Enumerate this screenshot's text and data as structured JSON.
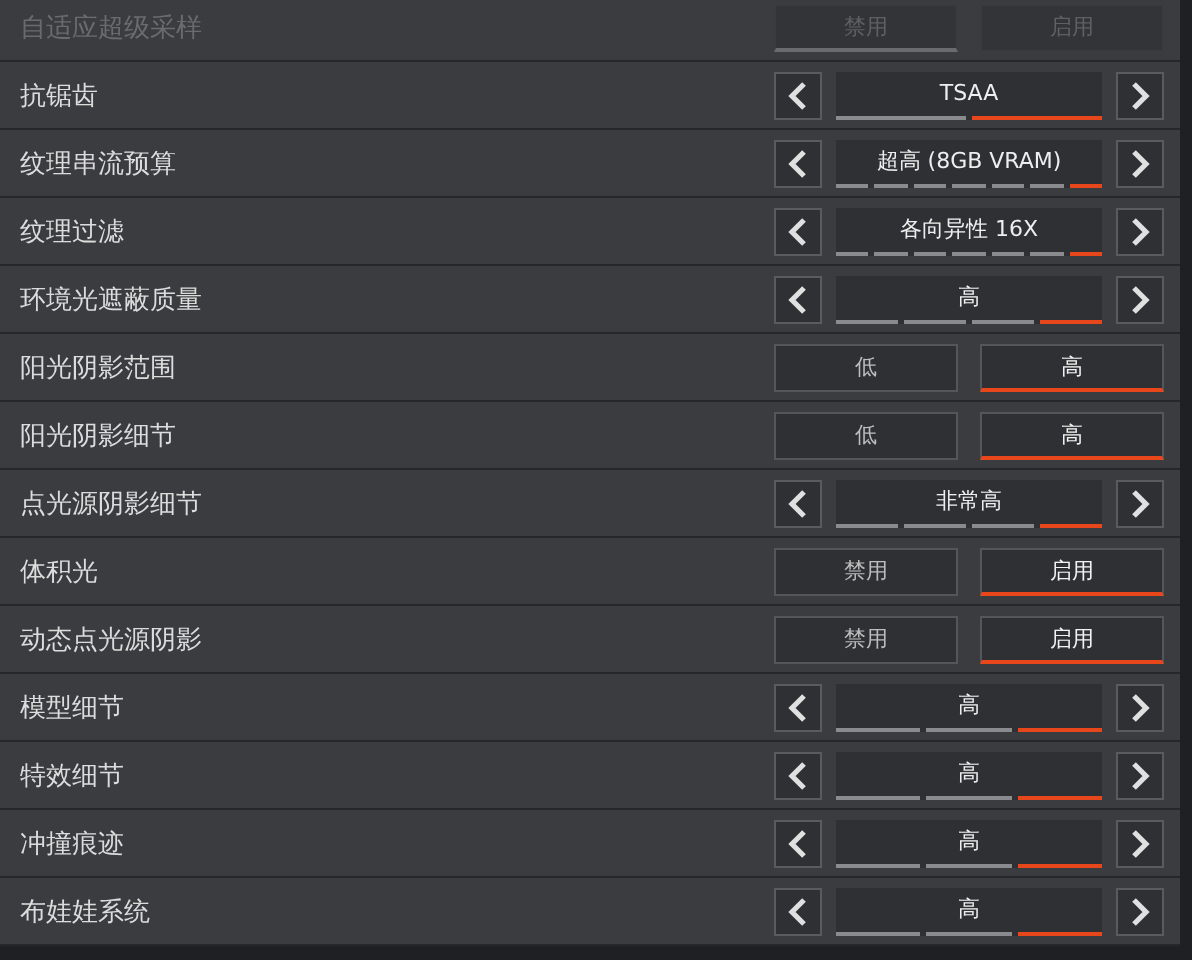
{
  "settings": [
    {
      "label": "自适应超级采样",
      "kind": "toggle",
      "disabled": true,
      "options": [
        {
          "label": "禁用",
          "selected": true
        },
        {
          "label": "启用",
          "selected": false
        }
      ]
    },
    {
      "label": "抗锯齿",
      "kind": "stepper",
      "disabled": false,
      "value": "TSAA",
      "segments": [
        {
          "selected": false
        },
        {
          "selected": true
        }
      ]
    },
    {
      "label": "纹理串流预算",
      "kind": "stepper",
      "disabled": false,
      "value": "超高 (8GB VRAM)",
      "segments": [
        {
          "selected": false
        },
        {
          "selected": false
        },
        {
          "selected": false
        },
        {
          "selected": false
        },
        {
          "selected": false
        },
        {
          "selected": false
        },
        {
          "selected": true
        }
      ]
    },
    {
      "label": "纹理过滤",
      "kind": "stepper",
      "disabled": false,
      "value": "各向异性 16X",
      "segments": [
        {
          "selected": false
        },
        {
          "selected": false
        },
        {
          "selected": false
        },
        {
          "selected": false
        },
        {
          "selected": false
        },
        {
          "selected": false
        },
        {
          "selected": true
        }
      ]
    },
    {
      "label": "环境光遮蔽质量",
      "kind": "stepper",
      "disabled": false,
      "value": "高",
      "segments": [
        {
          "selected": false
        },
        {
          "selected": false
        },
        {
          "selected": false
        },
        {
          "selected": true
        }
      ]
    },
    {
      "label": "阳光阴影范围",
      "kind": "toggle",
      "disabled": false,
      "options": [
        {
          "label": "低",
          "selected": false
        },
        {
          "label": "高",
          "selected": true
        }
      ]
    },
    {
      "label": "阳光阴影细节",
      "kind": "toggle",
      "disabled": false,
      "options": [
        {
          "label": "低",
          "selected": false
        },
        {
          "label": "高",
          "selected": true
        }
      ]
    },
    {
      "label": "点光源阴影细节",
      "kind": "stepper",
      "disabled": false,
      "value": "非常高",
      "segments": [
        {
          "selected": false
        },
        {
          "selected": false
        },
        {
          "selected": false
        },
        {
          "selected": true
        }
      ]
    },
    {
      "label": "体积光",
      "kind": "toggle",
      "disabled": false,
      "options": [
        {
          "label": "禁用",
          "selected": false
        },
        {
          "label": "启用",
          "selected": true
        }
      ]
    },
    {
      "label": "动态点光源阴影",
      "kind": "toggle",
      "disabled": false,
      "options": [
        {
          "label": "禁用",
          "selected": false
        },
        {
          "label": "启用",
          "selected": true
        }
      ]
    },
    {
      "label": "模型细节",
      "kind": "stepper",
      "disabled": false,
      "value": "高",
      "segments": [
        {
          "selected": false
        },
        {
          "selected": false
        },
        {
          "selected": true
        }
      ]
    },
    {
      "label": "特效细节",
      "kind": "stepper",
      "disabled": false,
      "value": "高",
      "segments": [
        {
          "selected": false
        },
        {
          "selected": false
        },
        {
          "selected": true
        }
      ]
    },
    {
      "label": "冲撞痕迹",
      "kind": "stepper",
      "disabled": false,
      "value": "高",
      "segments": [
        {
          "selected": false
        },
        {
          "selected": false
        },
        {
          "selected": true
        }
      ]
    },
    {
      "label": "布娃娃系统",
      "kind": "stepper",
      "disabled": false,
      "value": "高",
      "segments": [
        {
          "selected": false
        },
        {
          "selected": false
        },
        {
          "selected": true
        }
      ]
    }
  ]
}
